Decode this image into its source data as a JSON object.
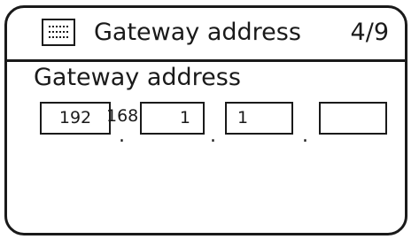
{
  "header": {
    "title": "Gateway address",
    "page_indicator": "4/9",
    "icon": "menu-list-icon"
  },
  "field": {
    "label": "Gateway address",
    "octets": [
      "192",
      "1",
      "1",
      ""
    ],
    "overflow_text": "168",
    "separator": "."
  }
}
